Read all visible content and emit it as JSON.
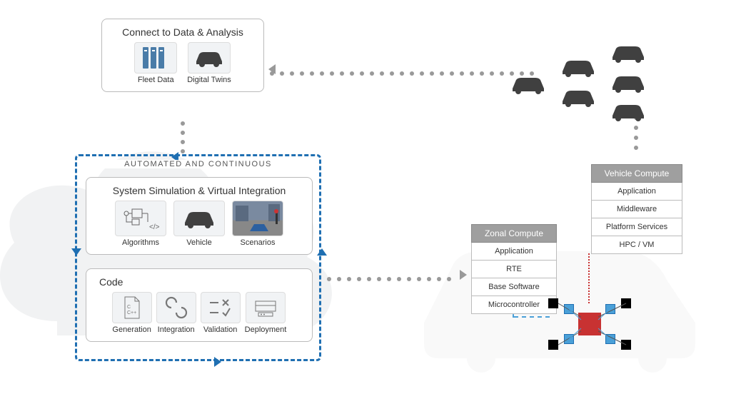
{
  "connect": {
    "title": "Connect to Data & Analysis",
    "items": [
      {
        "label": "Fleet Data",
        "icon": "server-icon"
      },
      {
        "label": "Digital Twins",
        "icon": "car-icon"
      }
    ]
  },
  "automated_label": "AUTOMATED AND CONTINUOUS",
  "simulation": {
    "title": "System Simulation & Virtual Integration",
    "items": [
      {
        "label": "Algorithms",
        "icon": "block-diagram-icon"
      },
      {
        "label": "Vehicle",
        "icon": "car-icon"
      },
      {
        "label": "Scenarios",
        "icon": "street-scene-icon"
      }
    ]
  },
  "code": {
    "title": "Code",
    "items": [
      {
        "label": "Generation",
        "icon": "cpp-file-icon"
      },
      {
        "label": "Integration",
        "icon": "link-icon"
      },
      {
        "label": "Validation",
        "icon": "check-x-icon"
      },
      {
        "label": "Deployment",
        "icon": "deploy-icon"
      }
    ]
  },
  "zonal": {
    "header": "Zonal Compute",
    "layers": [
      "Application",
      "RTE",
      "Base Software",
      "Microcontroller"
    ]
  },
  "vehicle": {
    "header": "Vehicle Compute",
    "layers": [
      "Application",
      "Middleware",
      "Platform Services",
      "HPC / VM"
    ]
  },
  "colors": {
    "dashed_border": "#1f6fb2",
    "chip": "#c83232",
    "dot": "#999999",
    "stack_header": "#9f9f9f"
  }
}
